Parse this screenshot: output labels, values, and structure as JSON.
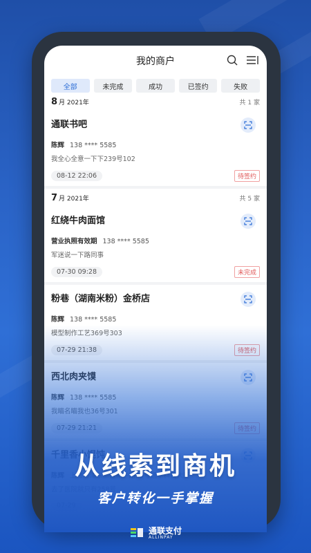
{
  "header": {
    "title": "我的商户"
  },
  "filters": [
    "全部",
    "未完成",
    "成功",
    "已签约",
    "失败"
  ],
  "groups": [
    {
      "month": "8",
      "year_suffix": "月 2021年",
      "count": "共 1 家"
    },
    {
      "month": "7",
      "year_suffix": "月 2021年",
      "count": "共 5 家"
    }
  ],
  "merchants": [
    {
      "name": "通联书吧",
      "person": "陈辉",
      "phone": "138 **** 5585",
      "addr": "我全心全意一下下239号102",
      "time": "08-12 22:06",
      "status": "待签约"
    },
    {
      "name": "红绕牛肉面馆",
      "person": "营业执照有效期",
      "phone": "138 **** 5585",
      "addr": "军迷说一下路同事",
      "time": "07-30 09:28",
      "status": "未完成"
    },
    {
      "name": "粉巷（湖南米粉）金桥店",
      "person": "陈辉",
      "phone": "138 **** 5585",
      "addr": "模型制作工艺369号303",
      "time": "07-29 21:38",
      "status": "待签约"
    },
    {
      "name": "西北肉夹馍",
      "person": "陈辉",
      "phone": "138 **** 5585",
      "addr": "我瞄名瞄我也36号301",
      "time": "07-29 21:21",
      "status": "待签约"
    },
    {
      "name": "千里香小馄饨",
      "person": "陈辉",
      "phone": "上海市浦东新区新沪路55号通华科技大厦",
      "addr": "去了医院就只有258号",
      "time": "07-29",
      "status": ""
    }
  ],
  "promo": {
    "headline": "从线索到商机",
    "subline": "客户转化一手掌握"
  },
  "brand": {
    "name": "通联支付",
    "sub": "ALLINPAY"
  },
  "colors": {
    "accent": "#2f6fd6",
    "warn": "#e05a5a"
  }
}
